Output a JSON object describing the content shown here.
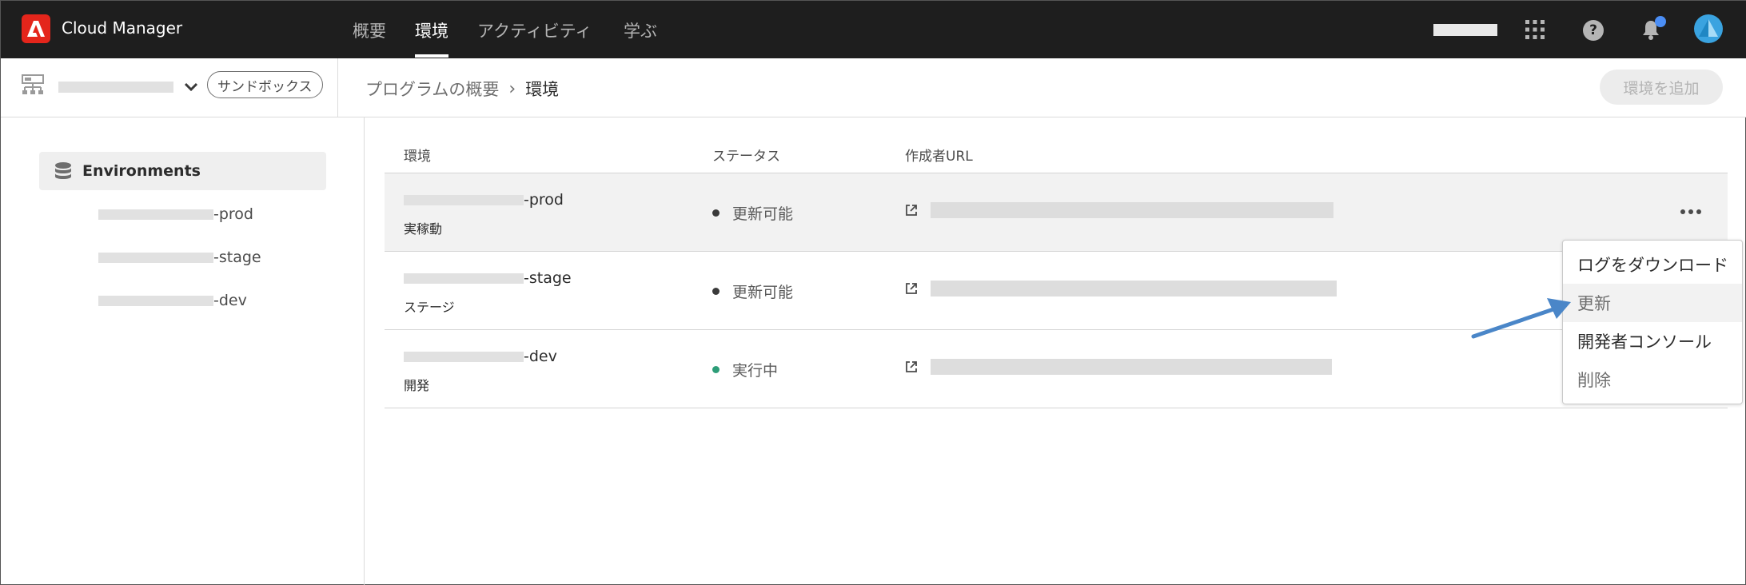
{
  "app": {
    "title": "Cloud Manager",
    "logo_icon": "adobe-logo-icon",
    "brand_color": "#e4251b"
  },
  "nav": {
    "tabs": [
      {
        "label": "概要",
        "active": false
      },
      {
        "label": "環境",
        "active": true
      },
      {
        "label": "アクティビティ",
        "active": false
      },
      {
        "label": "学ぶ",
        "active": false
      }
    ]
  },
  "topbar_icons": [
    "apps-grid-icon",
    "help-icon",
    "bell-icon",
    "avatar"
  ],
  "subheader": {
    "sandbox_badge": "サンドボックス",
    "breadcrumb": {
      "parent": "プログラムの概要",
      "separator": "›",
      "current": "環境"
    },
    "add_button": "環境を追加"
  },
  "sidebar": {
    "heading": "Environments",
    "items": [
      {
        "suffix": "-prod"
      },
      {
        "suffix": "-stage"
      },
      {
        "suffix": "-dev"
      }
    ]
  },
  "table": {
    "headers": {
      "env": "環境",
      "status": "ステータス",
      "url": "作成者URL"
    },
    "rows": [
      {
        "name_suffix": "-prod",
        "type": "実稼動",
        "status": "更新可能",
        "status_color": "#3a3a3a",
        "highlighted": true
      },
      {
        "name_suffix": "-stage",
        "type": "ステージ",
        "status": "更新可能",
        "status_color": "#3a3a3a",
        "highlighted": false
      },
      {
        "name_suffix": "-dev",
        "type": "開発",
        "status": "実行中",
        "status_color": "#2d9d78",
        "highlighted": false
      }
    ]
  },
  "menu": {
    "items": [
      {
        "label": "ログをダウンロード"
      },
      {
        "label": "更新"
      },
      {
        "label": "開発者コンソール"
      },
      {
        "label": "削除"
      }
    ],
    "highlighted_index": 1
  },
  "annotation": {
    "arrow_color": "#4a86c8"
  }
}
